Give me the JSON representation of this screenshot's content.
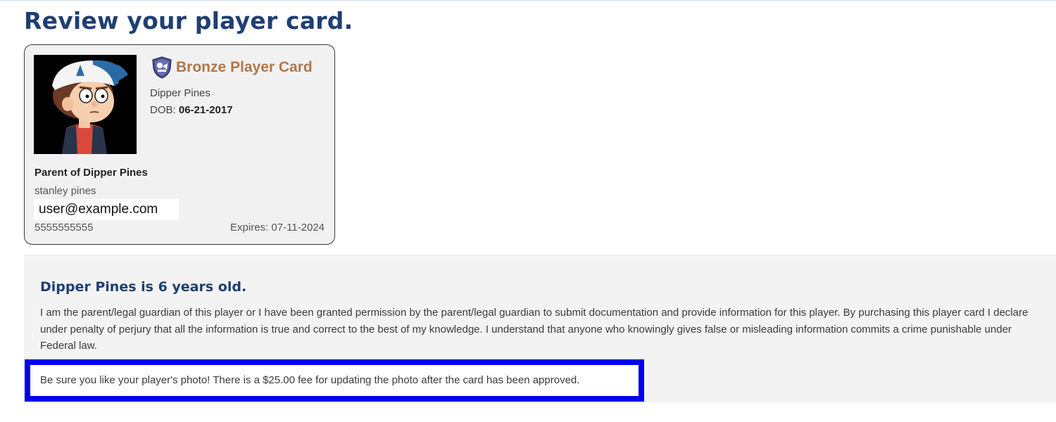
{
  "page": {
    "title": "Review your player card."
  },
  "card": {
    "tier": "Bronze Player Card",
    "player_name": "Dipper Pines",
    "dob_label": "DOB:",
    "dob_value": "06-21-2017",
    "parent_label": "Parent of Dipper Pines",
    "parent_name": "stanley pines",
    "email": "user@example.com",
    "phone": "5555555555",
    "expires": "Expires: 07-11-2024",
    "icons": [
      "shield-icon",
      "player-photo"
    ]
  },
  "info": {
    "age_heading": "Dipper Pines is 6 years old.",
    "declaration": "I am the parent/legal guardian of this player or I have been granted permission by the parent/legal guardian to submit documentation and provide information for this player. By purchasing this player card I declare under penalty of perjury that all the information is true and correct to the best of my knowledge. I understand that anyone who knowingly gives false or misleading information commits a crime punishable under Federal law.",
    "photo_notice": "Be sure you like your player's photo! There is a $25.00 fee for updating the photo after the card has been approved."
  },
  "colors": {
    "heading": "#1f3f73",
    "tier": "#b0764a",
    "highlight_border": "#0000ee",
    "panel_bg": "#f3f3f3",
    "card_bg": "#f1f1f1"
  }
}
